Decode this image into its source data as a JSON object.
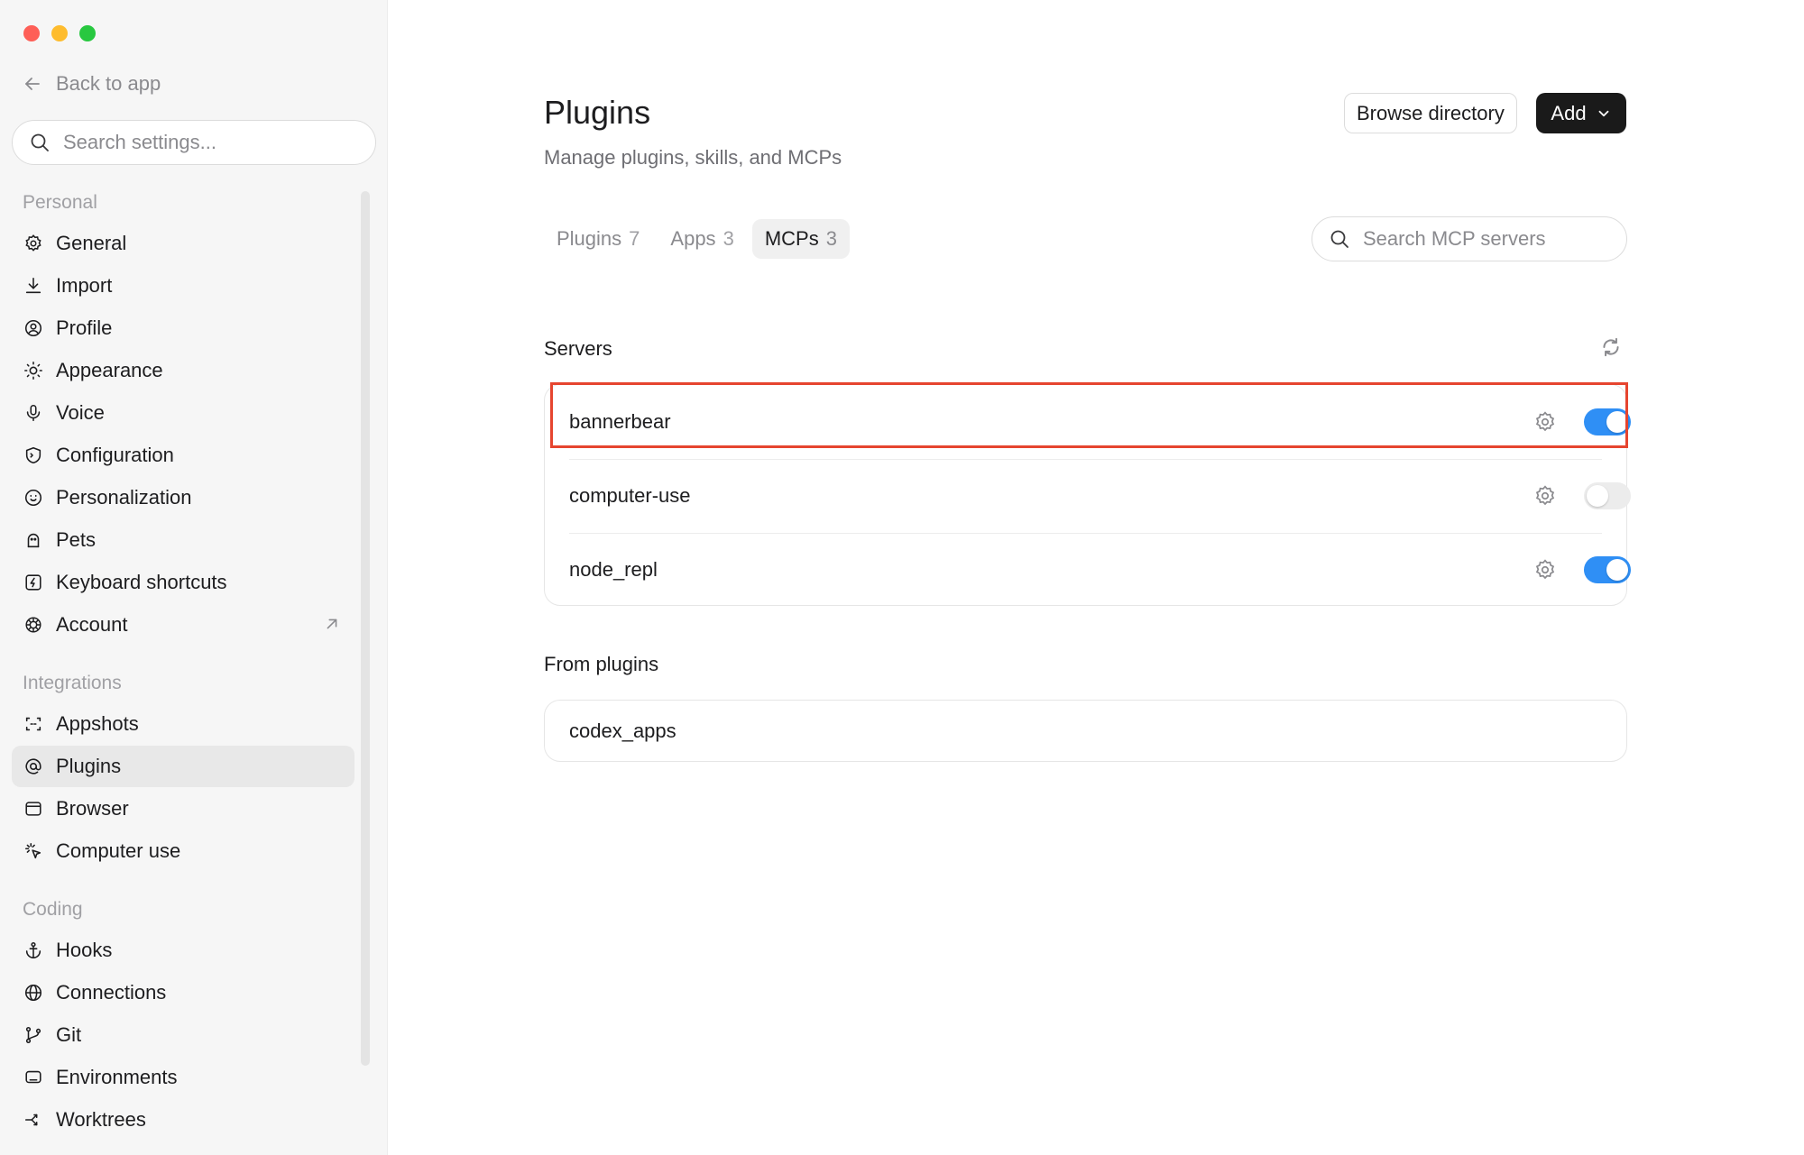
{
  "sidebar": {
    "back_label": "Back to app",
    "search_placeholder": "Search settings...",
    "sections": {
      "personal": "Personal",
      "integrations": "Integrations",
      "coding": "Coding"
    },
    "items": [
      {
        "label": "General",
        "icon": "gear-icon"
      },
      {
        "label": "Import",
        "icon": "download-icon"
      },
      {
        "label": "Profile",
        "icon": "user-circle-icon"
      },
      {
        "label": "Appearance",
        "icon": "sun-icon"
      },
      {
        "label": "Voice",
        "icon": "microphone-icon"
      },
      {
        "label": "Configuration",
        "icon": "terminal-shield-icon"
      },
      {
        "label": "Personalization",
        "icon": "smile-circle-icon"
      },
      {
        "label": "Pets",
        "icon": "pet-icon"
      },
      {
        "label": "Keyboard shortcuts",
        "icon": "bolt-square-icon"
      },
      {
        "label": "Account",
        "icon": "openai-logo-icon"
      },
      {
        "label": "Appshots",
        "icon": "capture-frame-icon"
      },
      {
        "label": "Plugins",
        "icon": "at-sign-icon"
      },
      {
        "label": "Browser",
        "icon": "browser-window-icon"
      },
      {
        "label": "Computer use",
        "icon": "cursor-click-icon"
      },
      {
        "label": "Hooks",
        "icon": "anchor-icon"
      },
      {
        "label": "Connections",
        "icon": "globe-icon"
      },
      {
        "label": "Git",
        "icon": "git-branch-icon"
      },
      {
        "label": "Environments",
        "icon": "monitor-icon"
      },
      {
        "label": "Worktrees",
        "icon": "worktree-icon"
      }
    ],
    "active_item": "Plugins"
  },
  "main": {
    "title": "Plugins",
    "subtitle": "Manage plugins, skills, and MCPs",
    "browse_label": "Browse directory",
    "add_label": "Add",
    "tabs": [
      {
        "label": "Plugins",
        "count": "7"
      },
      {
        "label": "Apps",
        "count": "3"
      },
      {
        "label": "MCPs",
        "count": "3"
      }
    ],
    "active_tab": "MCPs",
    "search_placeholder": "Search MCP servers",
    "servers_heading": "Servers",
    "servers": [
      {
        "name": "bannerbear",
        "enabled": true
      },
      {
        "name": "computer-use",
        "enabled": false
      },
      {
        "name": "node_repl",
        "enabled": true
      }
    ],
    "from_plugins_heading": "From plugins",
    "plugin_servers": [
      {
        "name": "codex_apps"
      }
    ]
  },
  "colors": {
    "accent": "#2f8ff5",
    "highlight": "#e6452f",
    "add_button": "#1a1a1a"
  }
}
